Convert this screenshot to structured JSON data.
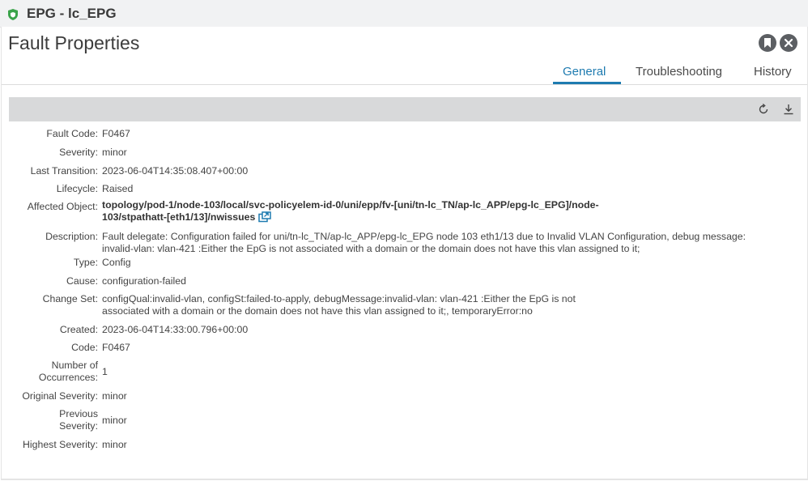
{
  "window": {
    "title": "EPG - lc_EPG",
    "icon": "shield-icon",
    "accent": "#3aa34a"
  },
  "panel": {
    "title": "Fault Properties",
    "buttons": [
      {
        "name": "bookmark-icon"
      },
      {
        "name": "close-icon"
      }
    ]
  },
  "tabs": [
    {
      "label": "General",
      "active": true
    },
    {
      "label": "Troubleshooting",
      "active": false
    },
    {
      "label": "History",
      "active": false
    }
  ],
  "toolbar": {
    "icons": [
      "refresh-icon",
      "download-icon"
    ]
  },
  "properties": {
    "fault_code": {
      "label": "Fault Code:",
      "value": "F0467"
    },
    "severity": {
      "label": "Severity:",
      "value": "minor"
    },
    "last_transition": {
      "label": "Last Transition:",
      "value": "2023-06-04T14:35:08.407+00:00"
    },
    "lifecycle": {
      "label": "Lifecycle:",
      "value": "Raised"
    },
    "affected_object": {
      "label": "Affected Object:",
      "value_line1": "topology/pod-1/node-103/local/svc-policyelem-id-0/uni/epp/fv-[uni/tn-lc_TN/ap-lc_APP/epg-lc_EPG]/node-",
      "value_line2": "103/stpathatt-[eth1/13]/nwissues"
    },
    "description": {
      "label": "Description:",
      "value_line1": "Fault delegate: Configuration failed for uni/tn-lc_TN/ap-lc_APP/epg-lc_EPG node 103 eth1/13 due to Invalid VLAN Configuration, debug message:",
      "value_line2": "invalid-vlan: vlan-421 :Either the EpG is not associated with a domain or the domain does not have this vlan assigned to it;"
    },
    "type": {
      "label": "Type:",
      "value": "Config"
    },
    "cause": {
      "label": "Cause:",
      "value": "configuration-failed"
    },
    "change_set": {
      "label": "Change Set:",
      "value_line1": "configQual:invalid-vlan, configSt:failed-to-apply, debugMessage:invalid-vlan: vlan-421 :Either the EpG is not",
      "value_line2": "associated with a domain or the domain does not have this vlan assigned to it;, temporaryError:no"
    },
    "created": {
      "label": "Created:",
      "value": "2023-06-04T14:33:00.796+00:00"
    },
    "code": {
      "label": "Code:",
      "value": "F0467"
    },
    "occurrences": {
      "label_line1": "Number of",
      "label_line2": "Occurrences:",
      "value": "1"
    },
    "original_severity": {
      "label": "Original Severity:",
      "value": "minor"
    },
    "previous_severity": {
      "label_line1": "Previous",
      "label_line2": "Severity:",
      "value": "minor"
    },
    "highest_severity": {
      "label": "Highest Severity:",
      "value": "minor"
    }
  }
}
